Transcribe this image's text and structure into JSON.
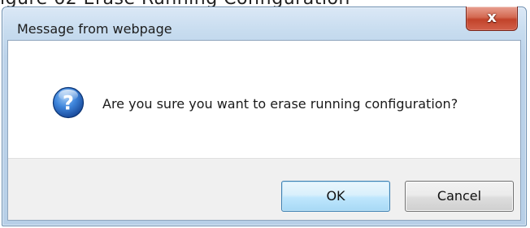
{
  "background_text": "igure 62 Erase Running Configuration",
  "dialog": {
    "title": "Message from webpage",
    "close_label": "x",
    "message": "Are you sure you want to erase running configuration?",
    "icon": "question-icon",
    "buttons": {
      "ok_label": "OK",
      "cancel_label": "Cancel"
    }
  },
  "colors": {
    "close_button": "#c2432a",
    "ok_button_border": "#3c7fb1",
    "icon_blue": "#1f63c4"
  }
}
